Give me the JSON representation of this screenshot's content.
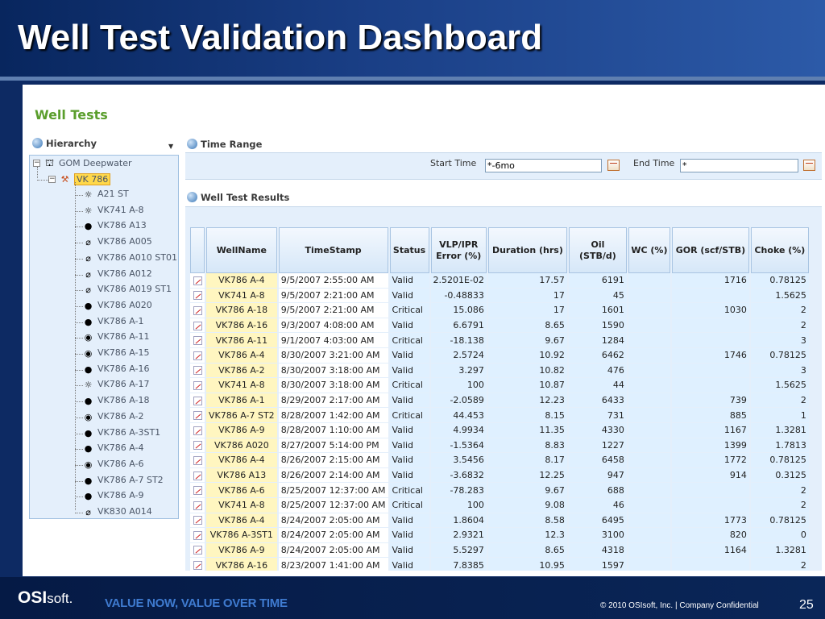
{
  "slide": {
    "title": "Well Test Validation Dashboard"
  },
  "footer": {
    "logo_bold": "OSI",
    "logo_rest": "soft.",
    "tagline": "VALUE NOW, VALUE OVER TIME",
    "copyright": "© 2010 OSIsoft, Inc.  |  Company Confidential",
    "page": "25"
  },
  "app": {
    "title": "Well Tests"
  },
  "hierarchy": {
    "heading": "Hierarchy",
    "root": "GOM Deepwater",
    "selected": "VK 786",
    "wells": [
      {
        "name": "A21 ST",
        "icon": "sun-icon"
      },
      {
        "name": "VK741 A-8",
        "icon": "sun-icon"
      },
      {
        "name": "VK786 A13",
        "icon": "dot-icon"
      },
      {
        "name": "VK786 A005",
        "icon": "injector-icon"
      },
      {
        "name": "VK786 A010 ST01",
        "icon": "injector-icon"
      },
      {
        "name": "VK786 A012",
        "icon": "injector-icon"
      },
      {
        "name": "VK786 A019 ST1",
        "icon": "injector-icon"
      },
      {
        "name": "VK786 A020",
        "icon": "dot-icon"
      },
      {
        "name": "VK786 A-1",
        "icon": "dot-icon"
      },
      {
        "name": "VK786 A-11",
        "icon": "target-icon"
      },
      {
        "name": "VK786 A-15",
        "icon": "target-icon"
      },
      {
        "name": "VK786 A-16",
        "icon": "dot-icon"
      },
      {
        "name": "VK786 A-17",
        "icon": "sun-icon"
      },
      {
        "name": "VK786 A-18",
        "icon": "dot-icon"
      },
      {
        "name": "VK786 A-2",
        "icon": "target-icon"
      },
      {
        "name": "VK786 A-3ST1",
        "icon": "dot-icon"
      },
      {
        "name": "VK786 A-4",
        "icon": "dot-icon"
      },
      {
        "name": "VK786 A-6",
        "icon": "target-icon"
      },
      {
        "name": "VK786 A-7 ST2",
        "icon": "dot-icon"
      },
      {
        "name": "VK786 A-9",
        "icon": "dot-icon"
      },
      {
        "name": "VK830 A014",
        "icon": "injector-icon"
      }
    ]
  },
  "time_range": {
    "heading": "Time Range",
    "start_label": "Start Time",
    "start_value": "*-6mo",
    "end_label": "End Time",
    "end_value": "*"
  },
  "results": {
    "heading": "Well Test Results",
    "columns": [
      "WellName",
      "TimeStamp",
      "Status",
      "VLP/IPR Error (%)",
      "Duration (hrs)",
      "Oil (STB/d)",
      "WC (%)",
      "GOR (scf/STB)",
      "Choke (%)"
    ],
    "rows": [
      [
        "VK786 A-4",
        "9/5/2007 2:55:00 AM",
        "Valid",
        "2.5201E-02",
        "17.57",
        "6191",
        "",
        "1716",
        "0.78125"
      ],
      [
        "VK741 A-8",
        "9/5/2007 2:21:00 AM",
        "Valid",
        "-0.48833",
        "17",
        "45",
        "",
        "",
        "1.5625"
      ],
      [
        "VK786 A-18",
        "9/5/2007 2:21:00 AM",
        "Critical",
        "15.086",
        "17",
        "1601",
        "",
        "1030",
        "2"
      ],
      [
        "VK786 A-16",
        "9/3/2007 4:08:00 AM",
        "Valid",
        "6.6791",
        "8.65",
        "1590",
        "",
        "",
        "2"
      ],
      [
        "VK786 A-11",
        "9/1/2007 4:03:00 AM",
        "Critical",
        "-18.138",
        "9.67",
        "1284",
        "",
        "",
        "3"
      ],
      [
        "VK786 A-4",
        "8/30/2007 3:21:00 AM",
        "Valid",
        "2.5724",
        "10.92",
        "6462",
        "",
        "1746",
        "0.78125"
      ],
      [
        "VK786 A-2",
        "8/30/2007 3:18:00 AM",
        "Valid",
        "3.297",
        "10.82",
        "476",
        "",
        "",
        "3"
      ],
      [
        "VK741 A-8",
        "8/30/2007 3:18:00 AM",
        "Critical",
        "100",
        "10.87",
        "44",
        "",
        "",
        "1.5625"
      ],
      [
        "VK786 A-1",
        "8/29/2007 2:17:00 AM",
        "Valid",
        "-2.0589",
        "12.23",
        "6433",
        "",
        "739",
        "2"
      ],
      [
        "VK786 A-7 ST2",
        "8/28/2007 1:42:00 AM",
        "Critical",
        "44.453",
        "8.15",
        "731",
        "",
        "885",
        "1"
      ],
      [
        "VK786 A-9",
        "8/28/2007 1:10:00 AM",
        "Valid",
        "4.9934",
        "11.35",
        "4330",
        "",
        "1167",
        "1.3281"
      ],
      [
        "VK786 A020",
        "8/27/2007 5:14:00 PM",
        "Valid",
        "-1.5364",
        "8.83",
        "1227",
        "",
        "1399",
        "1.7813"
      ],
      [
        "VK786 A-4",
        "8/26/2007 2:15:00 AM",
        "Valid",
        "3.5456",
        "8.17",
        "6458",
        "",
        "1772",
        "0.78125"
      ],
      [
        "VK786 A13",
        "8/26/2007 2:14:00 AM",
        "Valid",
        "-3.6832",
        "12.25",
        "947",
        "",
        "914",
        "0.3125"
      ],
      [
        "VK786 A-6",
        "8/25/2007 12:37:00 AM",
        "Critical",
        "-78.283",
        "9.67",
        "688",
        "",
        "",
        "2"
      ],
      [
        "VK741 A-8",
        "8/25/2007 12:37:00 AM",
        "Critical",
        "100",
        "9.08",
        "46",
        "",
        "",
        "2"
      ],
      [
        "VK786 A-4",
        "8/24/2007 2:05:00 AM",
        "Valid",
        "1.8604",
        "8.58",
        "6495",
        "",
        "1773",
        "0.78125"
      ],
      [
        "VK786 A-3ST1",
        "8/24/2007 2:05:00 AM",
        "Valid",
        "2.9321",
        "12.3",
        "3100",
        "",
        "820",
        "0"
      ],
      [
        "VK786 A-9",
        "8/24/2007 2:05:00 AM",
        "Valid",
        "5.5297",
        "8.65",
        "4318",
        "",
        "1164",
        "1.3281"
      ],
      [
        "VK786 A-16",
        "8/23/2007 1:41:00 AM",
        "Valid",
        "7.8385",
        "10.95",
        "1597",
        "",
        "",
        "2"
      ]
    ]
  }
}
